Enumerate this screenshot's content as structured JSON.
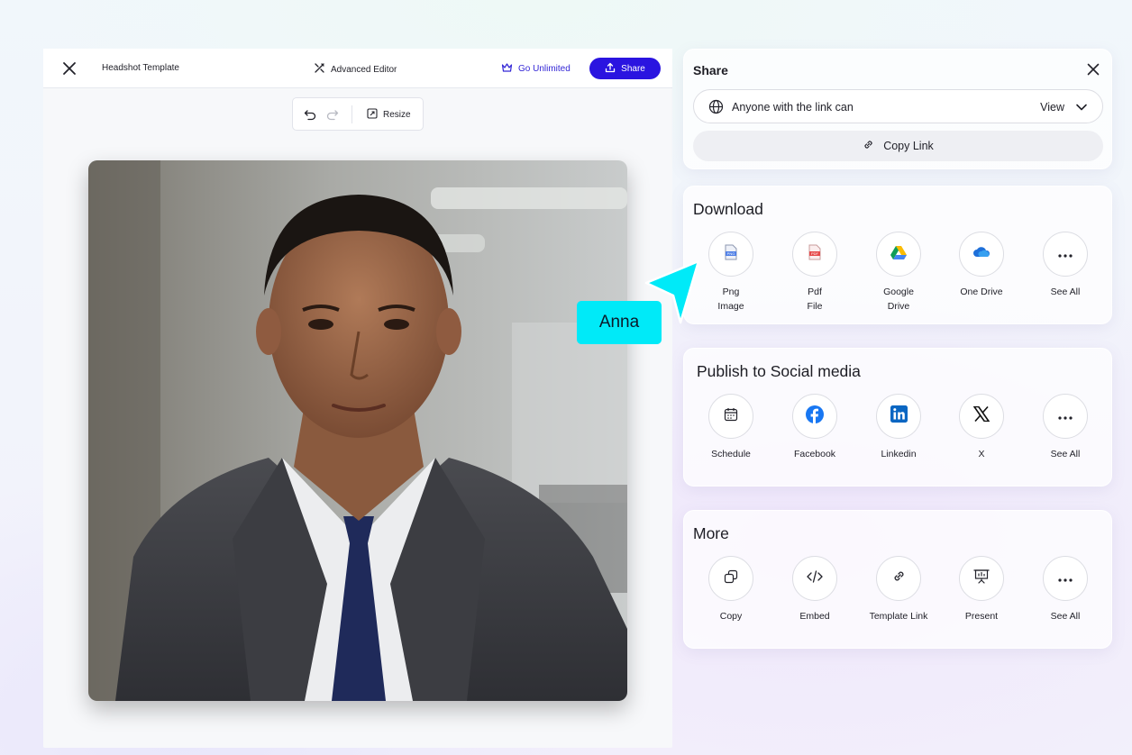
{
  "editor": {
    "title": "Headshot Template",
    "advanced_editor": "Advanced Editor",
    "go_unlimited": "Go Unlimited",
    "share_label": "Share",
    "toolbar": {
      "resize_label": "Resize"
    }
  },
  "share_panel": {
    "title": "Share",
    "permission_text": "Anyone with the link can",
    "permission_value": "View",
    "copy_link": "Copy Link"
  },
  "download": {
    "title": "Download",
    "items": [
      {
        "label": "Png\nImage",
        "icon": "png-file-icon"
      },
      {
        "label": "Pdf\nFile",
        "icon": "pdf-file-icon"
      },
      {
        "label": "Google\nDrive",
        "icon": "google-drive-icon"
      },
      {
        "label": "One Drive",
        "icon": "onedrive-icon"
      },
      {
        "label": "See All",
        "icon": "more-dots-icon"
      }
    ]
  },
  "social": {
    "title": "Publish to Social media",
    "items": [
      {
        "label": "Schedule",
        "icon": "calendar-icon"
      },
      {
        "label": "Facebook",
        "icon": "facebook-icon"
      },
      {
        "label": "Linkedin",
        "icon": "linkedin-icon"
      },
      {
        "label": "X",
        "icon": "x-logo-icon"
      },
      {
        "label": "See All",
        "icon": "more-dots-icon"
      }
    ]
  },
  "more": {
    "title": "More",
    "items": [
      {
        "label": "Copy",
        "icon": "copy-icon"
      },
      {
        "label": "Embed",
        "icon": "code-icon"
      },
      {
        "label": "Template Link",
        "icon": "link-icon"
      },
      {
        "label": "Present",
        "icon": "presentation-icon"
      },
      {
        "label": "See All",
        "icon": "more-dots-icon"
      }
    ]
  },
  "collaborator": {
    "name": "Anna"
  },
  "colors": {
    "accent": "#2a14e0",
    "cursor": "#00eaf8"
  }
}
